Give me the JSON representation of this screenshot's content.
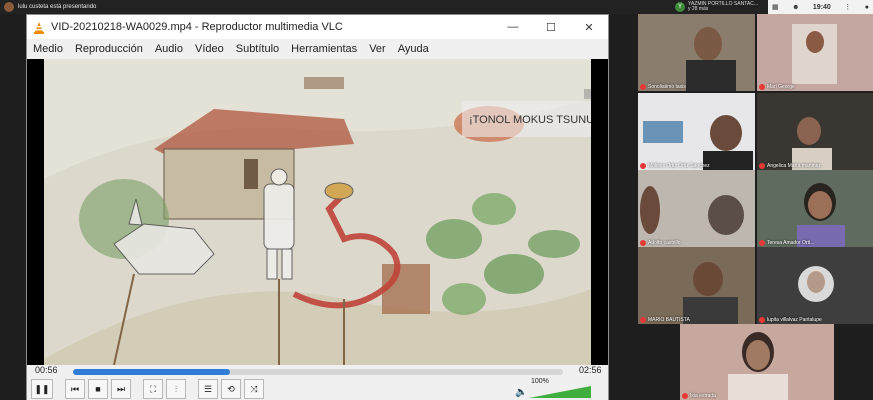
{
  "topbar": {
    "presenter_text": "lulu custeta está presentando",
    "speaker_name": "YAZMIN PORTILLO SANTAC...",
    "speaker_more": "y 28 más",
    "speaker_initial": "Y",
    "clock": "19:40"
  },
  "vlc": {
    "title": "VID-20210218-WA0029.mp4 - Reproductor multimedia VLC",
    "menu": [
      "Medio",
      "Reproducción",
      "Audio",
      "Vídeo",
      "Subtítulo",
      "Herramientas",
      "Ver",
      "Ayuda"
    ],
    "video_sign": "¡TONOL MOKUS TSUNUL!",
    "time_elapsed": "00:56",
    "time_total": "02:56",
    "progress": 0.32,
    "volume": "100%",
    "accent": "#2f7dd6"
  },
  "participants": [
    {
      "name": "Sonoliatimo taxis"
    },
    {
      "name": "Mari George"
    },
    {
      "name": "Molises Ortiz Ortiz Sanchez"
    },
    {
      "name": "Angelica María martinez"
    },
    {
      "name": "Adolfo castrillo"
    },
    {
      "name": "Teresa Amador Orti..."
    },
    {
      "name": "MARIO BAUTISTA"
    },
    {
      "name": "lupita villalvaz Pantalupe"
    },
    {
      "name": "Ixia estrada"
    }
  ]
}
